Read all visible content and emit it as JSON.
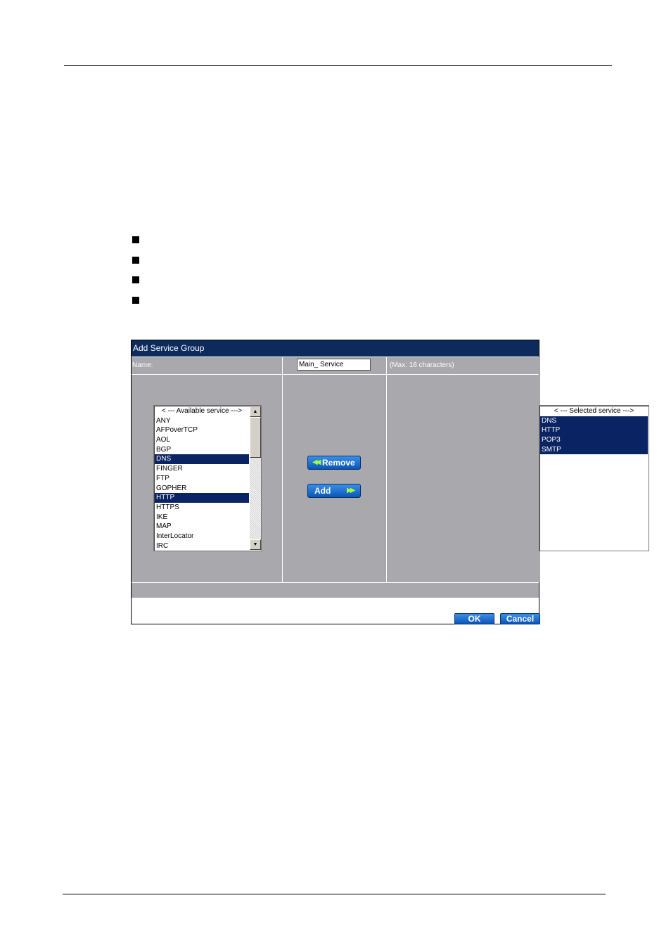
{
  "dialog": {
    "title": "Add Service Group",
    "name_label": "Name:",
    "name_value": "Main_ Service",
    "name_hint": "(Max. 16 characters)"
  },
  "available": {
    "header": "< --- Available service --->",
    "items": [
      "ANY",
      "AFPoverTCP",
      "AOL",
      "BGP",
      "DNS",
      "FINGER",
      "FTP",
      "GOPHER",
      "HTTP",
      "HTTPS",
      "IKE",
      "MAP",
      "InterLocator",
      "IRC"
    ],
    "highlighted": [
      "DNS",
      "HTTP"
    ]
  },
  "selected": {
    "header": "< --- Selected service --->",
    "items": [
      "DNS",
      "HTTP",
      "POP3",
      "SMTP"
    ]
  },
  "buttons": {
    "remove": "Remove",
    "add": "Add",
    "ok": "OK",
    "cancel": "Cancel"
  },
  "colors": {
    "titlebar": "#0d2a5c",
    "panel": "#a8a8ad",
    "highlight": "#0a2463",
    "button": "#0a55b8"
  }
}
